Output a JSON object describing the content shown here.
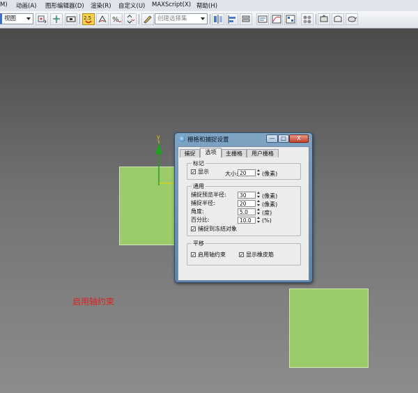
{
  "menubar": {
    "items": [
      "M)",
      "动画(A)",
      "图形编辑器(D)",
      "渲染(R)",
      "自定义(U)",
      "MAXScript(X)",
      "帮助(H)"
    ]
  },
  "toolbar": {
    "view_combo": "视图",
    "snap_toggle_label": "2.5",
    "selection_set_placeholder": "创建选择集"
  },
  "viewport": {
    "caption": "启用轴约束",
    "gizmo_axis_label": "y",
    "plane_color": "#9ccb69"
  },
  "dialog": {
    "title": "栅格和捕捉设置",
    "window_buttons": {
      "minimize": "—",
      "maximize": "□",
      "close": "X"
    },
    "tabs": [
      "捕捉",
      "选项",
      "主栅格",
      "用户栅格"
    ],
    "selected_tab": "选项",
    "marks": {
      "legend": "标记",
      "display_label": "显示",
      "display_checked": true,
      "size_label": "大小:",
      "size_value": "20",
      "size_unit": "(像素)"
    },
    "general": {
      "legend": "通用",
      "preview_radius_label": "捕捉预览半径:",
      "preview_radius_value": "30",
      "preview_radius_unit": "(像素)",
      "snap_radius_label": "捕捉半径:",
      "snap_radius_value": "20",
      "snap_radius_unit": "(像素)",
      "angle_label": "角度:",
      "angle_value": "5.0",
      "angle_unit": "(度)",
      "percent_label": "百分比:",
      "percent_value": "10.0",
      "percent_unit": "(%)",
      "frozen_label": "捕捉到冻结对象",
      "frozen_checked": true
    },
    "translation": {
      "legend": "平移",
      "axis_constraint_label": "启用轴约束",
      "axis_constraint_checked": true,
      "rubber_band_label": "显示橡皮筋",
      "rubber_band_checked": true
    }
  },
  "colors": {
    "accent_snap": "#f7d24a",
    "caption": "#e02020",
    "gizmo_y": "#22a022"
  }
}
